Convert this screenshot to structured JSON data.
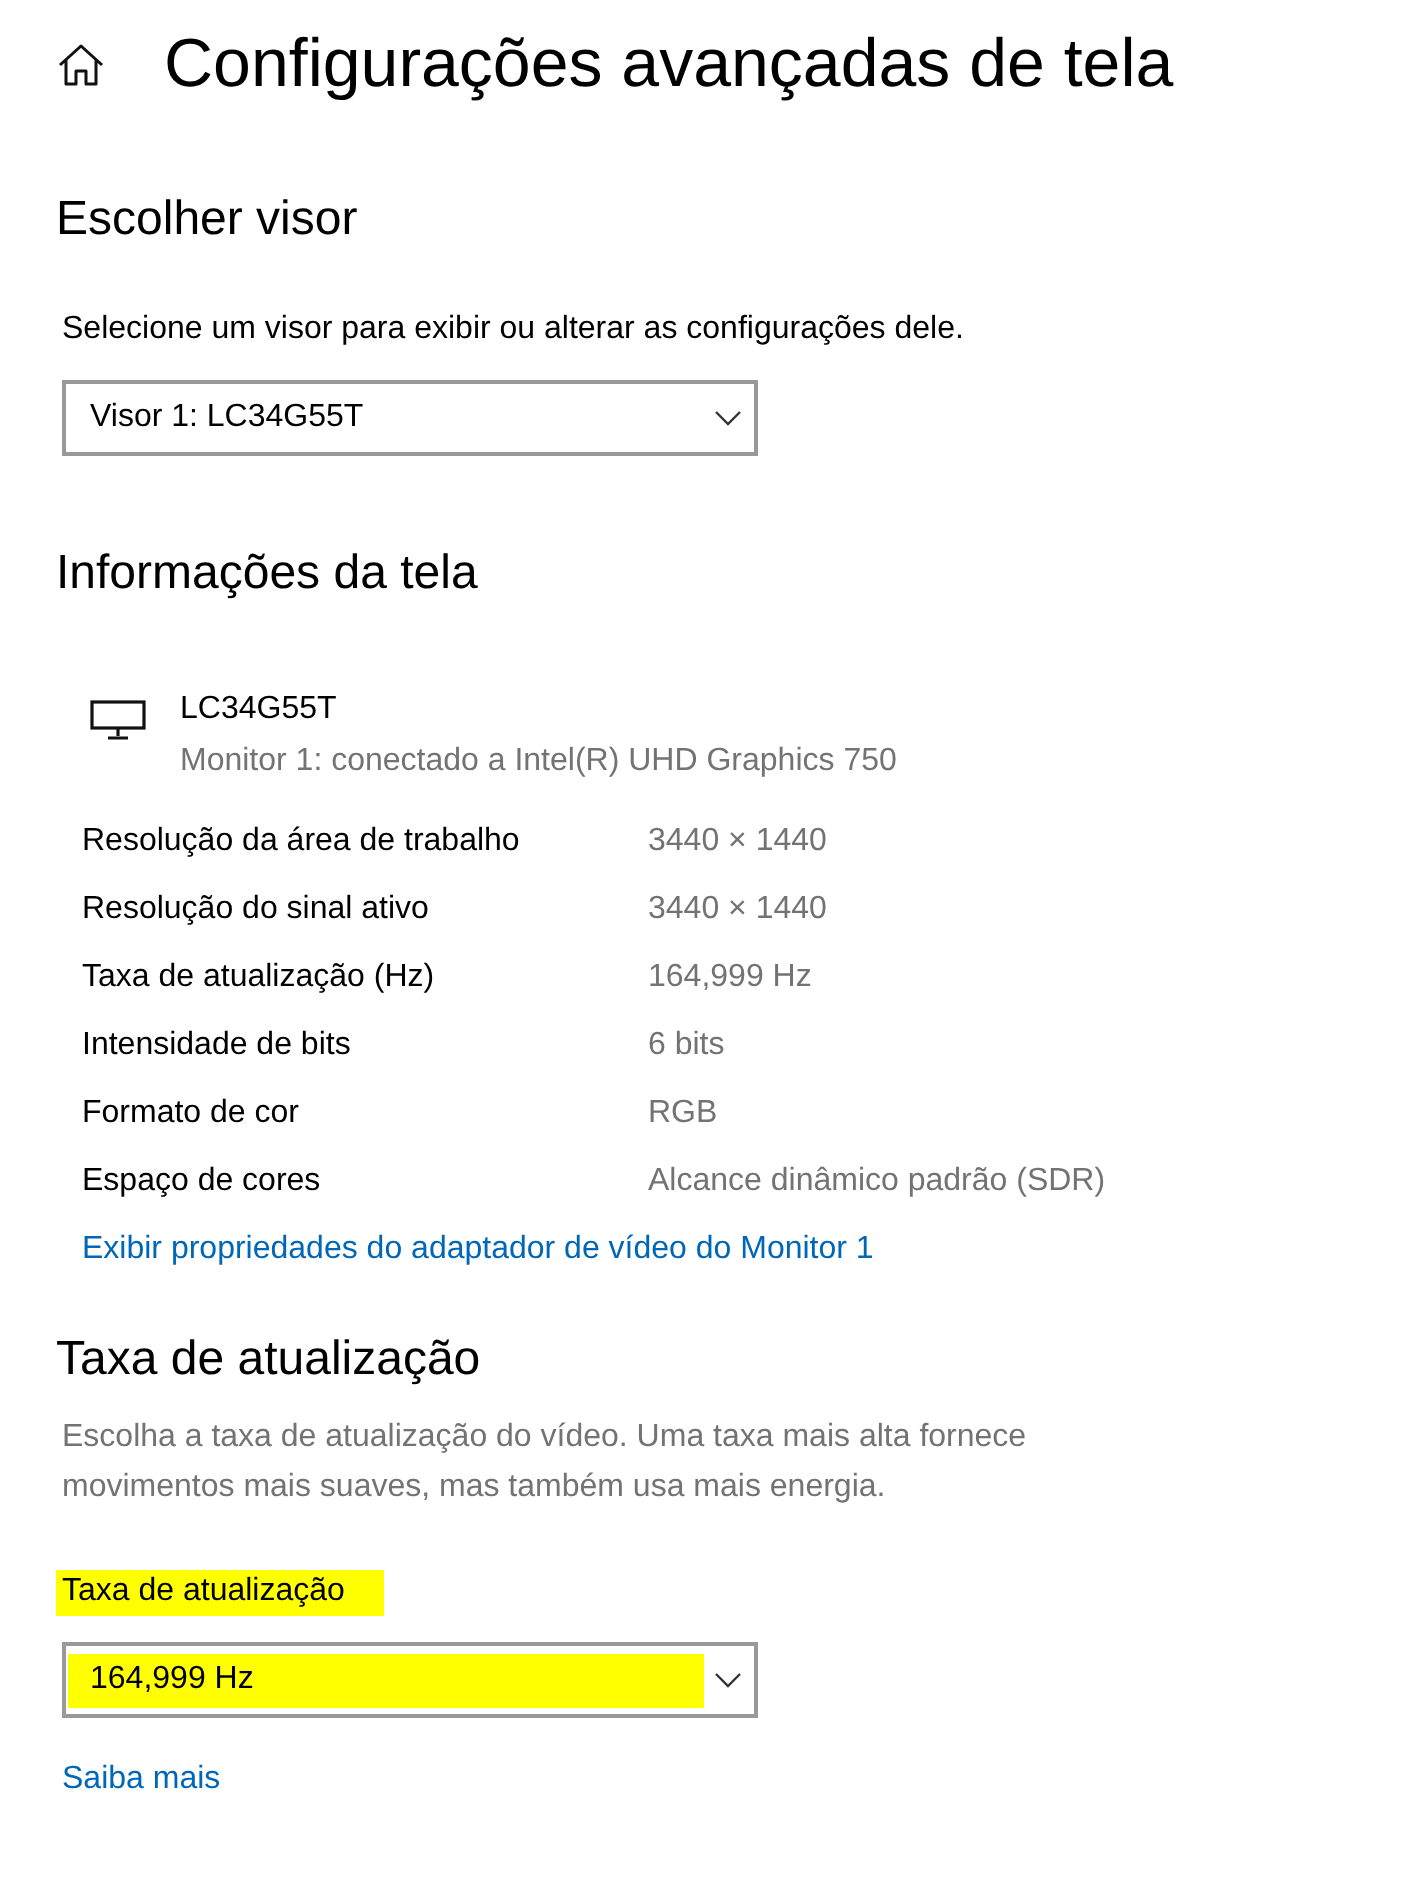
{
  "header": {
    "title": "Configurações avançadas de tela"
  },
  "choose_display": {
    "heading": "Escolher visor",
    "description": "Selecione um visor para exibir ou alterar as configurações dele.",
    "dropdown": {
      "value": "Visor 1: LC34G55T",
      "highlighted": false
    }
  },
  "display_info": {
    "heading": "Informações da tela",
    "monitor": {
      "name": "LC34G55T",
      "connection": "Monitor 1: conectado a Intel(R) UHD Graphics 750"
    },
    "rows": [
      {
        "label": "Resolução da área de trabalho",
        "value": "3440 × 1440"
      },
      {
        "label": "Resolução do sinal ativo",
        "value": "3440 × 1440"
      },
      {
        "label": "Taxa de atualização (Hz)",
        "value": "164,999 Hz"
      },
      {
        "label": "Intensidade de bits",
        "value": "6 bits"
      },
      {
        "label": "Formato de cor",
        "value": "RGB"
      },
      {
        "label": "Espaço de cores",
        "value": "Alcance dinâmico padrão (SDR)"
      }
    ],
    "link": "Exibir propriedades do adaptador de vídeo do Monitor 1"
  },
  "refresh_rate": {
    "heading": "Taxa de atualização",
    "description": "Escolha a taxa de atualização do vídeo. Uma taxa mais alta fornece movimentos mais suaves, mas também usa mais energia.",
    "field_label": {
      "text": "Taxa de atualização",
      "highlighted": true
    },
    "dropdown": {
      "value": "164,999 Hz",
      "highlighted": true
    },
    "link": "Saiba mais"
  }
}
